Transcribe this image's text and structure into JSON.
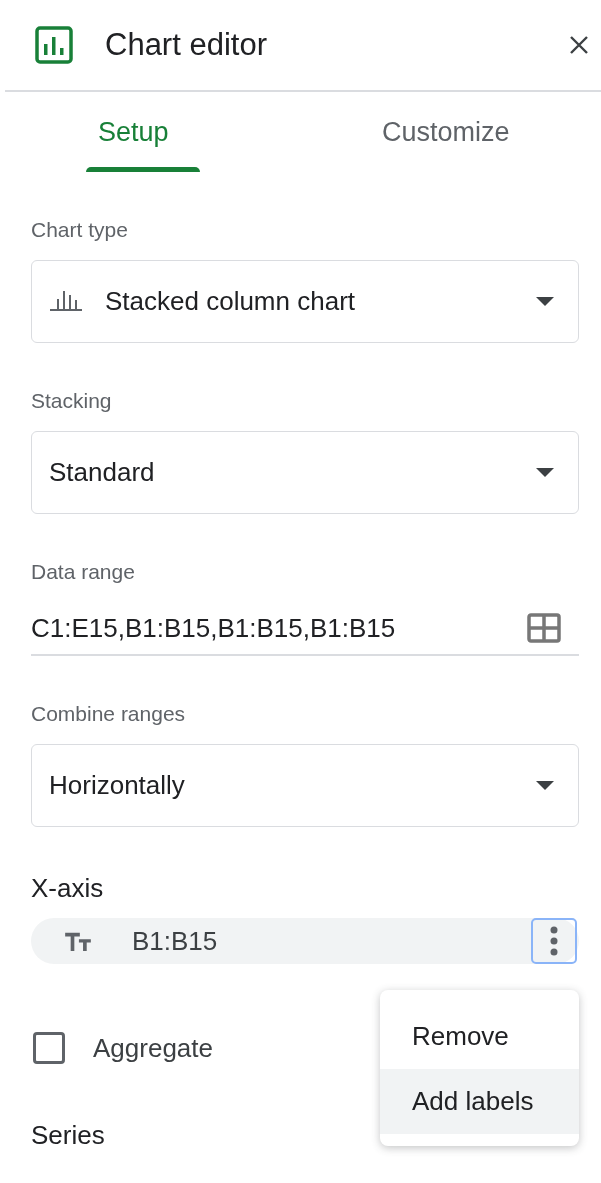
{
  "header": {
    "title": "Chart editor"
  },
  "tabs": [
    {
      "label": "Setup",
      "selected": true
    },
    {
      "label": "Customize",
      "selected": false
    }
  ],
  "fields": [
    {
      "kind": "chart_select",
      "label": "Chart type",
      "value": "Stacked column chart"
    },
    {
      "kind": "select",
      "label": "Stacking",
      "value": "Standard"
    },
    {
      "kind": "range",
      "label": "Data range",
      "value": "C1:E15,B1:B15,B1:B15,B1:B15"
    },
    {
      "kind": "select",
      "label": "Combine ranges",
      "value": "Horizontally"
    }
  ],
  "x_axis": {
    "heading": "X-axis",
    "range": "B1:B15",
    "menu_focused": true,
    "menu": [
      {
        "label": "Remove",
        "selected": false
      },
      {
        "label": "Add labels",
        "selected": true
      }
    ],
    "aggregate": {
      "label": "Aggregate",
      "checked": false
    }
  },
  "series": {
    "heading": "Series"
  }
}
